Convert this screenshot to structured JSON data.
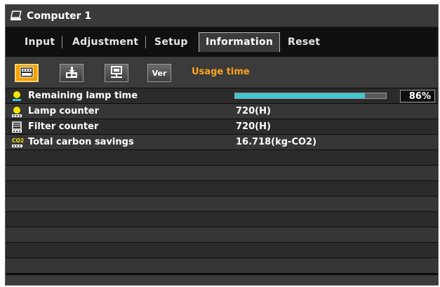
{
  "window": {
    "title": "Computer 1",
    "icon": "computer-icon"
  },
  "tabs": [
    {
      "label": "Input",
      "active": false
    },
    {
      "label": "Adjustment",
      "active": false
    },
    {
      "label": "Setup",
      "active": false
    },
    {
      "label": "Information",
      "active": true
    },
    {
      "label": "Reset",
      "active": false
    }
  ],
  "toolbar": {
    "buttons": [
      {
        "name": "usage-time-icon",
        "active": true
      },
      {
        "name": "source-icon",
        "active": false
      },
      {
        "name": "wired-lan-icon",
        "active": false
      },
      {
        "name": "version-button",
        "label": "Ver",
        "active": false
      }
    ],
    "section_title": "Usage time"
  },
  "rows": [
    {
      "label": "Remaining lamp time",
      "icon": "lamp-remaining-icon",
      "progress": 0.86,
      "percent_label": "86%"
    },
    {
      "label": "Lamp counter",
      "icon": "lamp-counter-icon",
      "value": "720(H)"
    },
    {
      "label": "Filter counter",
      "icon": "filter-counter-icon",
      "value": "720(H)"
    },
    {
      "label": "Total carbon savings",
      "icon": "co2-icon",
      "icon_text": "CO2",
      "value": "16.718(kg-CO2)"
    }
  ],
  "colors": {
    "accent_orange": "#f2a100",
    "section_title": "#ffa21a",
    "progress_fill": "#3fc7cf",
    "row_dark": "#2b2b2b",
    "row_light": "#363636"
  }
}
